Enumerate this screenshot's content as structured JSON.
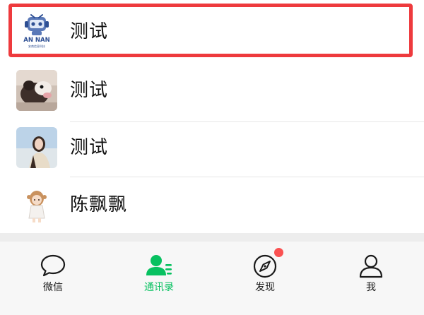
{
  "contacts": [
    {
      "name": "测试",
      "avatar": "an-nan-logo",
      "logo_text": "AN NAN",
      "logo_subtext": "安南信息科技"
    },
    {
      "name": "测试",
      "avatar": "dog-photo"
    },
    {
      "name": "测试",
      "avatar": "woman-photo"
    },
    {
      "name": "陈飘飘",
      "avatar": "cartoon-girl"
    }
  ],
  "tabs": [
    {
      "label": "微信",
      "icon": "chat-bubble-icon",
      "active": false
    },
    {
      "label": "通讯录",
      "icon": "contacts-icon",
      "active": true
    },
    {
      "label": "发现",
      "icon": "compass-icon",
      "active": false,
      "badge": true
    },
    {
      "label": "我",
      "icon": "person-icon",
      "active": false
    }
  ],
  "colors": {
    "accent": "#07c160",
    "highlight": "#ee3a3d",
    "badge": "#fa5151"
  }
}
